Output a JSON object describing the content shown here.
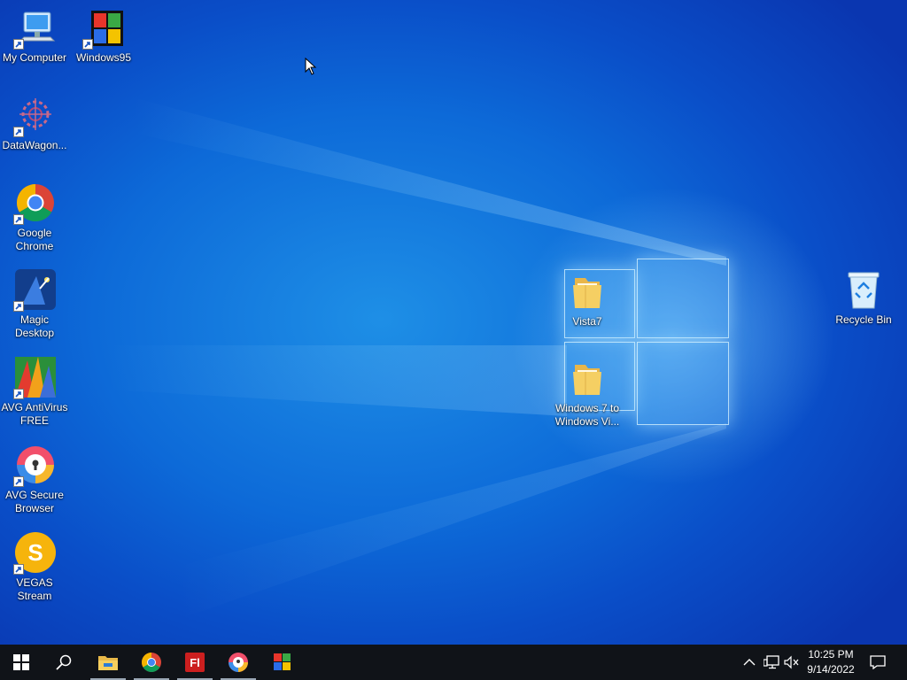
{
  "desktop": {
    "icons": [
      {
        "label": "My Computer",
        "icon": "computer-icon"
      },
      {
        "label": "Windows95",
        "icon": "windows95-logo-icon"
      },
      {
        "label": "DataWagon...",
        "icon": "datawagon-icon"
      },
      {
        "label": "Google\nChrome",
        "icon": "chrome-icon"
      },
      {
        "label": "Magic\nDesktop",
        "icon": "magic-desktop-icon"
      },
      {
        "label": "AVG AntiVirus\nFREE",
        "icon": "avg-antivirus-icon"
      },
      {
        "label": "AVG Secure\nBrowser",
        "icon": "avg-secure-browser-icon"
      },
      {
        "label": "VEGAS\nStream",
        "icon": "vegas-stream-icon"
      },
      {
        "label": "Vista7",
        "icon": "folder-icon"
      },
      {
        "label": "Windows 7 to\nWindows Vi...",
        "icon": "folder-icon"
      },
      {
        "label": "Recycle Bin",
        "icon": "recycle-bin-icon"
      }
    ]
  },
  "taskbar": {
    "pinned": [
      {
        "name": "start-button",
        "icon": "windows-start-icon"
      },
      {
        "name": "search-button",
        "icon": "search-icon"
      },
      {
        "name": "file-explorer",
        "icon": "file-explorer-icon",
        "running": true
      },
      {
        "name": "google-chrome",
        "icon": "chrome-icon",
        "running": true
      },
      {
        "name": "flash-app",
        "icon": "flash-icon",
        "running": true
      },
      {
        "name": "avg-secure-browser",
        "icon": "avg-secure-browser-icon",
        "running": true
      },
      {
        "name": "windows95",
        "icon": "windows95-logo-icon"
      }
    ],
    "tray": {
      "icons": [
        "chevron-up-icon",
        "network-icon",
        "volume-muted-icon",
        "notification-icon"
      ],
      "time": "10:25 PM",
      "date": "9/14/2022"
    }
  },
  "colors": {
    "desktop_blue": "#0d6ad8",
    "taskbar": "#101318"
  }
}
